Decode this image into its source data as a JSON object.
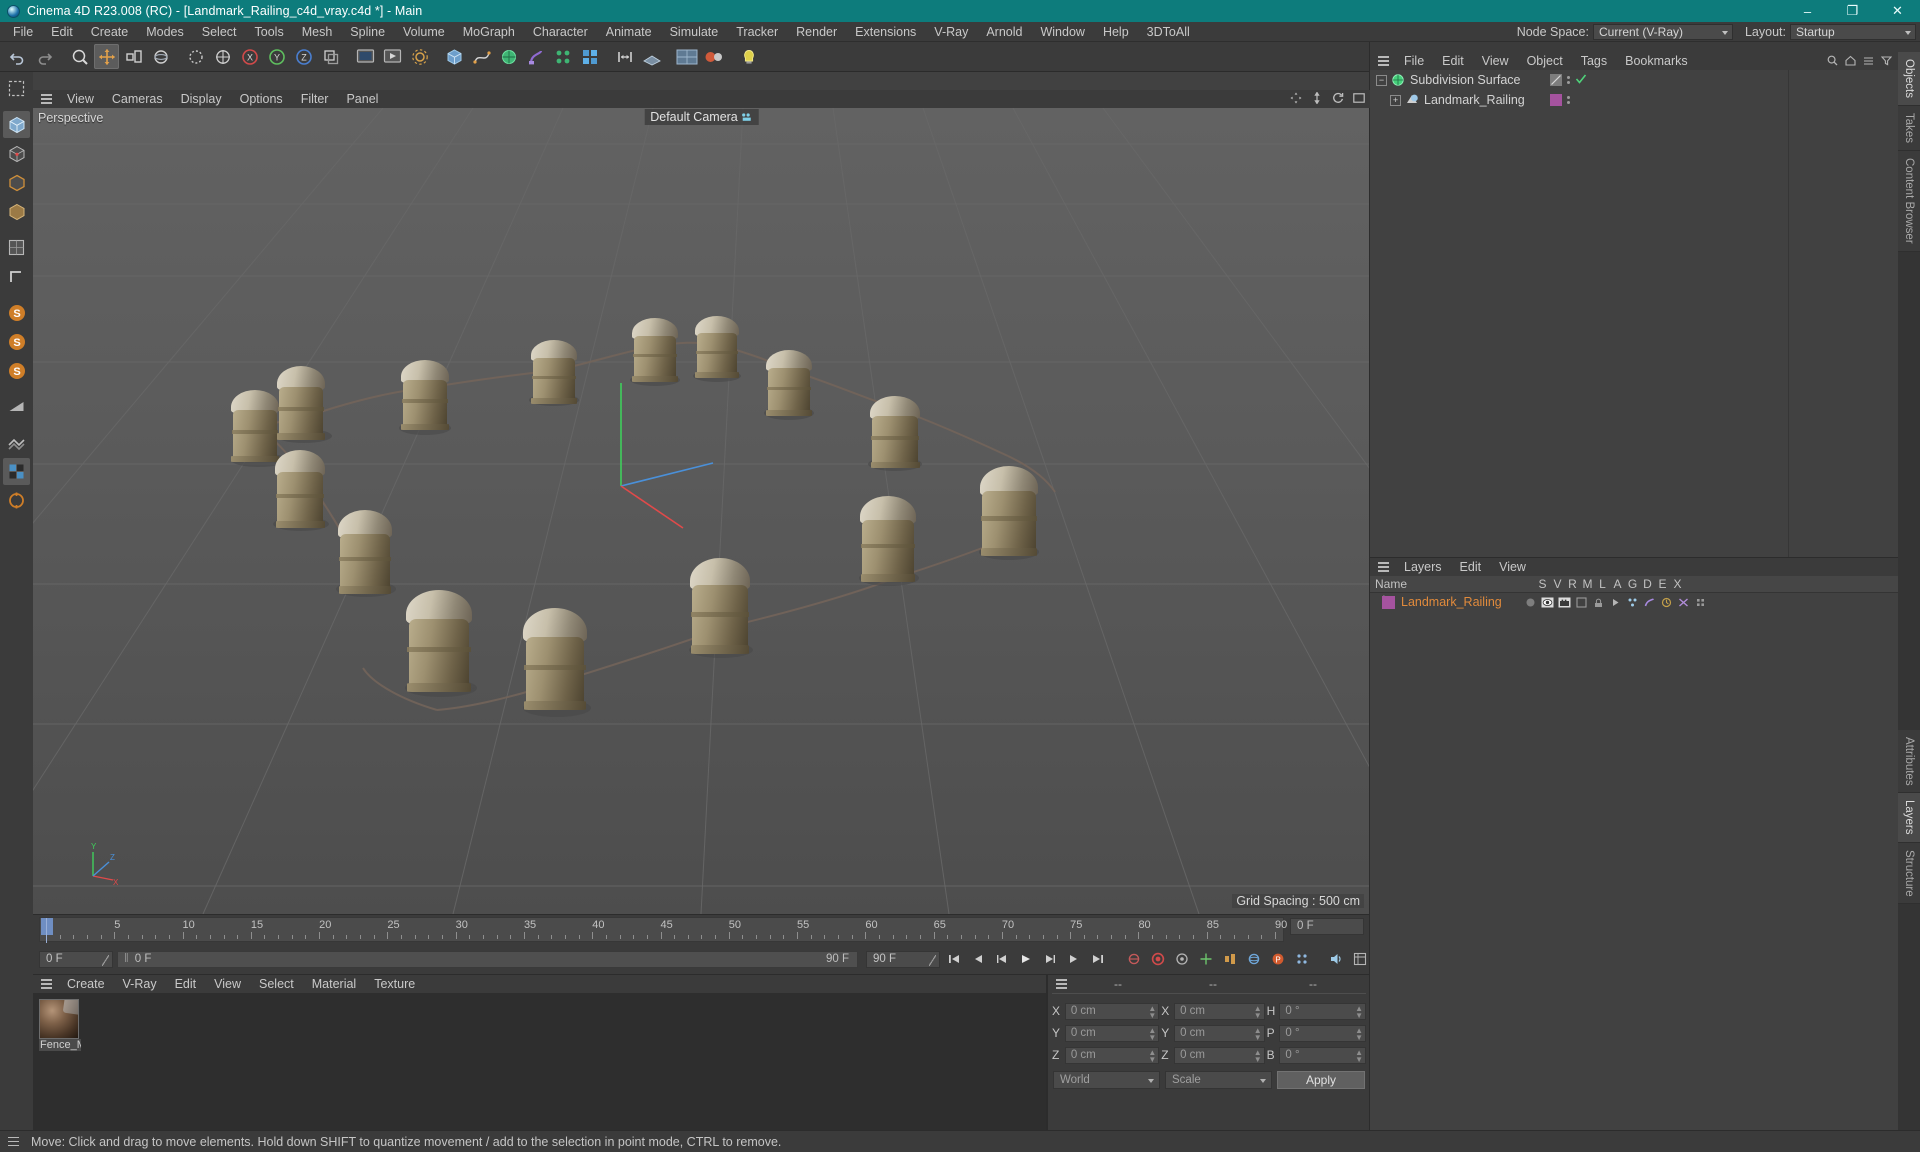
{
  "window": {
    "title": "Cinema 4D R23.008 (RC) - [Landmark_Railing_c4d_vray.c4d *] - Main",
    "minimize": "–",
    "maximize": "❐",
    "close": "✕"
  },
  "menubar": {
    "items": [
      "File",
      "Edit",
      "Create",
      "Modes",
      "Select",
      "Tools",
      "Mesh",
      "Spline",
      "Volume",
      "MoGraph",
      "Character",
      "Animate",
      "Simulate",
      "Tracker",
      "Render",
      "Extensions",
      "V-Ray",
      "Arnold",
      "Window",
      "Help",
      "3DToAll"
    ],
    "node_space_label": "Node Space:",
    "node_space_value": "Current (V-Ray)",
    "layout_label": "Layout:",
    "layout_value": "Startup"
  },
  "viewport": {
    "menu": [
      "View",
      "Cameras",
      "Display",
      "Options",
      "Filter",
      "Panel"
    ],
    "projection_label": "Perspective",
    "camera_label": "Default Camera",
    "grid_spacing": "Grid Spacing : 500 cm",
    "axis_x": "X",
    "axis_y": "Y",
    "axis_z": "Z"
  },
  "timeline": {
    "ticks": [
      "0",
      "5",
      "10",
      "15",
      "20",
      "25",
      "30",
      "35",
      "40",
      "45",
      "50",
      "55",
      "60",
      "65",
      "70",
      "75",
      "80",
      "85",
      "90"
    ],
    "current_frame": "0 F",
    "scrub_value": "0 F",
    "range_end": "90 F",
    "preview_end": "90 F",
    "end_field": "0 F",
    "playhead_frame": 0
  },
  "materials": {
    "menu": [
      "Create",
      "V-Ray",
      "Edit",
      "View",
      "Select",
      "Material",
      "Texture"
    ],
    "items": [
      {
        "name": "Fence_M"
      }
    ]
  },
  "coordinates": {
    "header": [
      "--",
      "--",
      "--"
    ],
    "position": {
      "label_x": "X",
      "label_y": "Y",
      "label_z": "Z",
      "x": "0 cm",
      "y": "0 cm",
      "z": "0 cm"
    },
    "size": {
      "label_x": "X",
      "label_y": "Y",
      "label_z": "Z",
      "x": "0 cm",
      "y": "0 cm",
      "z": "0 cm"
    },
    "rotation": {
      "label_h": "H",
      "label_p": "P",
      "label_b": "B",
      "h": "0 °",
      "p": "0 °",
      "b": "0 °"
    },
    "system": "World",
    "mode": "Scale",
    "apply": "Apply"
  },
  "objects_panel": {
    "menu": [
      "File",
      "Edit",
      "View",
      "Object",
      "Tags",
      "Bookmarks"
    ],
    "rows": [
      {
        "name": "Subdivision Surface",
        "depth": 0,
        "expander": "−",
        "icon": "subdivision-surface-icon",
        "icon_color": "#45d17a",
        "tag_color": "#8a8a8a",
        "checked": true
      },
      {
        "name": "Landmark_Railing",
        "depth": 1,
        "expander": "+",
        "icon": "polygon-object-icon",
        "icon_color": "#9ec9e8",
        "tag_color": "#a5539f",
        "checked": false
      }
    ]
  },
  "layers_panel": {
    "menu": [
      "Layers",
      "Edit",
      "View"
    ],
    "columns": [
      "Name",
      "S",
      "V",
      "R",
      "M",
      "L",
      "A",
      "G",
      "D",
      "E",
      "X"
    ],
    "rows": [
      {
        "name": "Landmark_Railing",
        "color": "#a5539f"
      }
    ]
  },
  "right_tabs": {
    "top": [
      "Objects",
      "Takes",
      "Content Browser"
    ],
    "bottom": [
      "Attributes",
      "Layers",
      "Structure"
    ]
  },
  "statusbar": {
    "message": "Move: Click and drag to move elements. Hold down SHIFT to quantize movement / add to the selection in point mode, CTRL to remove."
  },
  "toolbar": {
    "buttons": [
      {
        "name": "undo-button",
        "glyph": "↶"
      },
      {
        "name": "redo-button",
        "glyph": "↷"
      },
      {
        "name": "live-selection-button",
        "glyph": "⬤"
      },
      {
        "name": "move-tool-button",
        "glyph": "✛",
        "active": true
      },
      {
        "name": "scale-tool-button",
        "glyph": "▭"
      },
      {
        "name": "rotate-tool-button",
        "glyph": "↺"
      },
      {
        "name": "lock-axis-button",
        "glyph": "◌"
      },
      {
        "name": "world-object-axis-button",
        "glyph": "⌖"
      },
      {
        "name": "x-axis-button",
        "glyph": "X"
      },
      {
        "name": "y-axis-button",
        "glyph": "Y"
      },
      {
        "name": "z-axis-button",
        "glyph": "Z"
      },
      {
        "name": "object-axis-button",
        "glyph": "⧉"
      },
      {
        "name": "render-view-button",
        "glyph": "▣"
      },
      {
        "name": "render-queue-button",
        "glyph": "▶"
      },
      {
        "name": "render-settings-button",
        "glyph": "⚙"
      },
      {
        "name": "cube-primitive-button",
        "glyph": "▢"
      },
      {
        "name": "spline-pen-button",
        "glyph": "✎"
      },
      {
        "name": "subdivision-surface-button",
        "glyph": "⬡"
      },
      {
        "name": "bend-deformer-button",
        "glyph": "◔"
      },
      {
        "name": "array-button",
        "glyph": "❖"
      },
      {
        "name": "mograph-cloner-button",
        "glyph": "⁙"
      },
      {
        "name": "light-button",
        "glyph": "☀"
      },
      {
        "name": "camera-button",
        "glyph": "◎"
      },
      {
        "name": "floor-button",
        "glyph": "▬"
      },
      {
        "name": "material-sphere-button",
        "glyph": "⚫"
      },
      {
        "name": "help-button",
        "glyph": "❓"
      }
    ]
  },
  "lefttools": {
    "buttons": [
      {
        "name": "selection-tool-button",
        "glyph": "⬚"
      },
      {
        "name": "move-tool-left-button",
        "glyph": "⬡",
        "active": true
      },
      {
        "name": "scale-tool-left-button",
        "glyph": "▧"
      },
      {
        "name": "rotate-tool-left-button",
        "glyph": "◫"
      },
      {
        "name": "box-mode-button",
        "glyph": "▢"
      },
      {
        "name": "poly-mode-button",
        "glyph": "⬟"
      },
      {
        "name": "edge-mode-button",
        "glyph": "▭"
      },
      {
        "name": "point-mode-button",
        "glyph": "┗"
      },
      {
        "name": "snap-button-1",
        "glyph": "S"
      },
      {
        "name": "snap-button-2",
        "glyph": "S"
      },
      {
        "name": "snap-button-3",
        "glyph": "S"
      },
      {
        "name": "workplane-button",
        "glyph": "◢"
      },
      {
        "name": "texture-mode-button",
        "glyph": "▓"
      },
      {
        "name": "axis-mode-button",
        "glyph": "▦"
      },
      {
        "name": "enable-axis-button",
        "glyph": "⭘"
      }
    ]
  },
  "colors": {
    "title_teal": "#0d7c7c",
    "panel_bg": "#3b3b3b",
    "viewport_bg": "#585858",
    "accent_orange": "#e08a3c",
    "layer_purple": "#a5539f",
    "green": "#45d17a"
  }
}
